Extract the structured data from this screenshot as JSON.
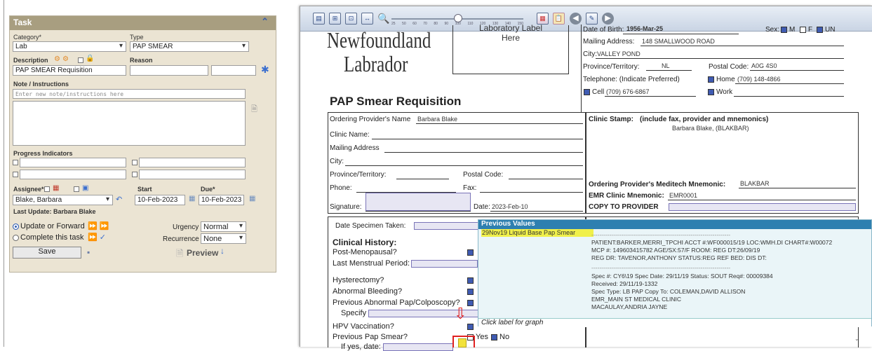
{
  "task": {
    "header": "Task",
    "category_label": "Category*",
    "category_value": "Lab",
    "type_label": "Type",
    "type_value": "PAP SMEAR",
    "description_label": "Description",
    "description_value": "PAP SMEAR Requisition",
    "reason_label": "Reason",
    "note_label": "Note / Instructions",
    "note_placeholder": "Enter new note/instructions here",
    "progress_label": "Progress Indicators",
    "assignee_label": "Assignee*",
    "assignee_value": "Blake, Barbara",
    "start_label": "Start",
    "start_value": "10-Feb-2023",
    "due_label": "Due*",
    "due_value": "10-Feb-2023",
    "last_update": "Last Update: Barbara Blake",
    "update_label": "Update or Forward",
    "complete_label": "Complete this task",
    "urgency_label": "Urgency",
    "urgency_value": "Normal",
    "recurrence_label": "Recurrence",
    "recurrence_value": "None",
    "save_label": "Save",
    "preview_label": "Preview"
  },
  "form": {
    "logo_line1": "Newfoundland",
    "logo_line2": "Labrador",
    "lab_label_line1": "Laboratory Label",
    "lab_label_line2": "Here",
    "title": "PAP Smear Requisition",
    "dob_label": "Date of Birth:",
    "dob_value": "1956-Mar-25",
    "sex_label": "Sex:",
    "sex_m": "M",
    "sex_f": "F",
    "sex_un": "UN",
    "mailing_label": "Mailing Address:",
    "mailing_value": "148 SMALLWOOD ROAD",
    "city_label": "City:",
    "city_value": "VALLEY POND",
    "province_label": "Province/Territory:",
    "province_value": "NL",
    "postal_label": "Postal Code:",
    "postal_value": "A0G 4S0",
    "telephone_label": "Telephone: (Indicate Preferred)",
    "home_label": "Home",
    "home_value": "(709) 148-4866",
    "cell_label": "Cell",
    "cell_value": "(709) 676-6867",
    "work_label": "Work",
    "ordering_provider_label": "Ordering Provider's Name",
    "ordering_provider_value": "Barbara Blake",
    "clinic_name_label": "Clinic Name:",
    "mailing2_label": "Mailing Address",
    "city2_label": "City:",
    "province2_label": "Province/Territory:",
    "postal2_label": "Postal Code:",
    "phone_label": "Phone:",
    "fax_label": "Fax:",
    "signature_label": "Signature:",
    "date_label": "Date:",
    "date_value": "2023-Feb-10",
    "clinic_stamp_label": "Clinic Stamp:",
    "clinic_stamp_hint": "(include fax, provider and mnemonics)",
    "clinic_stamp_value": "Barbara Blake, (BLAKBAR)",
    "meditech_label": "Ordering Provider's Meditech Mnemonic:",
    "meditech_value": "BLAKBAR",
    "emr_label": "EMR Clinic Mnemonic:",
    "emr_value": "EMR0001",
    "copy_label": "COPY TO PROVIDER",
    "date_specimen_label": "Date Specimen Taken:",
    "clinical_history_label": "Clinical History:",
    "post_meno": "Post-Menopausal?",
    "last_menstrual": "Last Menstrual Period:",
    "hysterectomy": "Hysterectomy?",
    "abnormal_bleeding": "Abnormal Bleeding?",
    "prev_abnormal": "Previous Abnormal Pap/Colposcopy?",
    "specify": "Specify",
    "hpv": "HPV Vaccination?",
    "prev_pap": "Previous Pap Smear?",
    "yes": "Yes",
    "no": "No",
    "if_yes": "If yes, date:"
  },
  "previous_values": {
    "title": "Previous Values",
    "highlight": "29Nov19 Liquid Base Pap Smear",
    "lines": [
      "----------------------------------------------------------------------",
      "PATIENT:BARKER,MERRI_TPCHI ACCT #:WF000015/19 LOC:WMH.DI CHART#:W00072",
      "MCP #: 149603415782 AGE/SX:57/F ROOM: REG DT:26/09/19",
      "REG DR: TAVENOR,ANTHONY STATUS:REG REF BED: DIS DT:",
      "----------------------------------------------------------------------",
      "Spec #: CY6\\19 Spec Date: 29/11/19 Status: SOUT Req#: 00009384",
      "Received: 29/11/19-1332",
      "Spec Type: LB PAP Copy To: COLEMAN,DAVID ALLISON",
      "EMR_MAIN ST MEDICAL CLINIC",
      "MACAULAY,ANDRIA JAYNE"
    ],
    "footer": "Click label for graph"
  },
  "toolbar": {
    "slider_ticks": [
      "25",
      "50",
      "60",
      "70",
      "80",
      "90",
      "100",
      "110",
      "120",
      "130",
      "140",
      "150"
    ]
  }
}
